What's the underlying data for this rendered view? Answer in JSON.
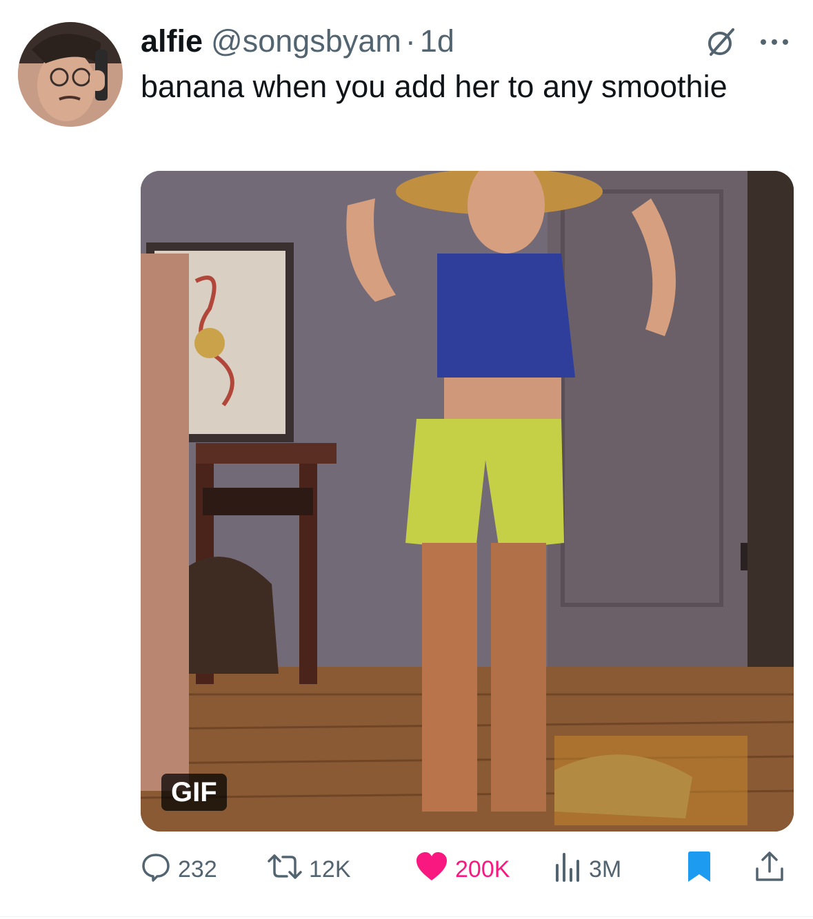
{
  "author": {
    "name": "alfie",
    "handle": "@songsbyam",
    "separator": "·",
    "time": "1d"
  },
  "tweet": {
    "text": "banana when you add her to any smoothie"
  },
  "media": {
    "badge": "GIF"
  },
  "actions": {
    "replies": "232",
    "retweets": "12K",
    "likes": "200K",
    "views": "3M"
  },
  "colors": {
    "like": "#f91880",
    "bookmark": "#1d9bf0",
    "muted": "#536471"
  },
  "icons": [
    "grok-icon",
    "more-icon",
    "reply-icon",
    "retweet-icon",
    "heart-icon",
    "views-icon",
    "bookmark-icon",
    "share-icon"
  ]
}
